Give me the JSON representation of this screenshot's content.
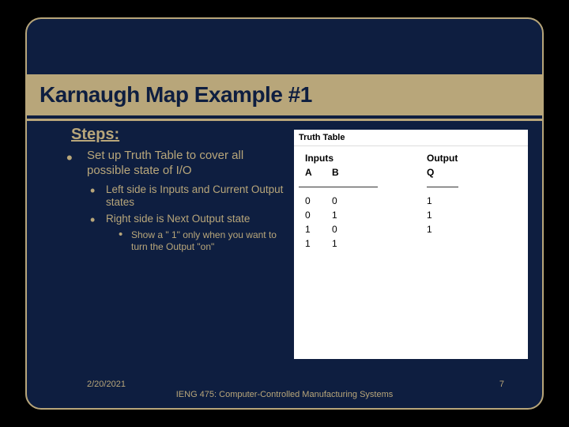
{
  "title": "Karnaugh Map Example #1",
  "stepsHeading": "Steps:",
  "bullets": {
    "l1": "Set up Truth Table to cover all possible state of I/O",
    "l2a": "Left side is Inputs and Current Output states",
    "l2b": "Right side is Next Output state",
    "l3": "Show a \" 1\" only when you want to turn the Output \"on\""
  },
  "truth": {
    "title": "Truth Table",
    "inputsLabel": "Inputs",
    "outputLabel": "Output",
    "cols": {
      "a": "A",
      "b": "B",
      "q": "Q"
    },
    "rows": [
      {
        "a": "0",
        "b": "0",
        "q": "1"
      },
      {
        "a": "0",
        "b": "1",
        "q": "1"
      },
      {
        "a": "1",
        "b": "0",
        "q": "1"
      },
      {
        "a": "1",
        "b": "1",
        "q": ""
      }
    ]
  },
  "footer": {
    "date": "2/20/2021",
    "course": "IENG 475: Computer-Controlled Manufacturing Systems",
    "page": "7"
  },
  "chart_data": {
    "type": "table",
    "title": "Truth Table",
    "columns": [
      "A",
      "B",
      "Q"
    ],
    "rows": [
      [
        "0",
        "0",
        "1"
      ],
      [
        "0",
        "1",
        "1"
      ],
      [
        "1",
        "0",
        "1"
      ],
      [
        "1",
        "1",
        ""
      ]
    ],
    "column_groups": {
      "Inputs": [
        "A",
        "B"
      ],
      "Output": [
        "Q"
      ]
    }
  }
}
